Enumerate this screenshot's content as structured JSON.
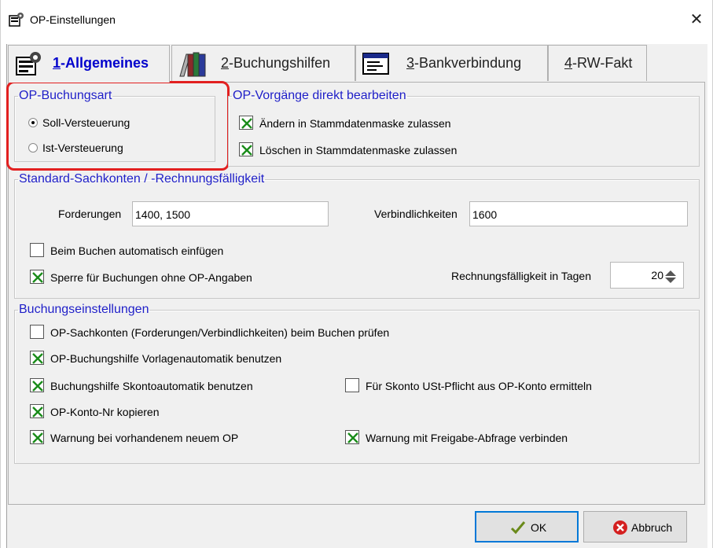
{
  "window": {
    "title": "OP-Einstellungen",
    "close_glyph": "✕",
    "icon": "settings-dialog-icon"
  },
  "tabs": [
    {
      "lead": "1",
      "rest": "-Allgemeines",
      "icon": "settings-icon",
      "active": true
    },
    {
      "lead": "2",
      "rest": "-Buchungshilfen",
      "icon": "books-icon",
      "active": false
    },
    {
      "lead": "3",
      "rest": "-Bankverbindung",
      "icon": "bank-window-icon",
      "active": false
    },
    {
      "lead": "4",
      "rest": "-RW-Fakt",
      "icon": "",
      "active": false
    }
  ],
  "buchungsart": {
    "legend": "OP-Buchungsart",
    "options": [
      {
        "label": "Soll-Versteuerung",
        "checked": true
      },
      {
        "label": "Ist-Versteuerung",
        "checked": false
      }
    ],
    "highlight_color": "#e22020"
  },
  "vorgaenge": {
    "legend": "OP-Vorgänge direkt bearbeiten",
    "items": [
      {
        "label": "Ändern in Stammdatenmaske zulassen",
        "checked": true
      },
      {
        "label": "Löschen in Stammdatenmaske zulassen",
        "checked": true
      }
    ]
  },
  "sachkonten": {
    "legend": "Standard-Sachkonten / -Rechnungsfälligkeit",
    "forderungen_label": "Forderungen",
    "forderungen_value": "1400, 1500",
    "verbindlichkeiten_label": "Verbindlichkeiten",
    "verbindlichkeiten_value": "1600",
    "auto_einfuegen": {
      "label": "Beim Buchen automatisch einfügen",
      "checked": false
    },
    "sperre": {
      "label": "Sperre für Buchungen ohne OP-Angaben",
      "checked": true
    },
    "faelligkeit_label": "Rechnungsfälligkeit in Tagen",
    "faelligkeit_value": "20"
  },
  "einstellungen": {
    "legend": "Buchungseinstellungen",
    "items": [
      {
        "label": "OP-Sachkonten (Forderungen/Verbindlichkeiten) beim Buchen prüfen",
        "checked": false
      },
      {
        "label": "OP-Buchungshilfe Vorlagenautomatik benutzen",
        "checked": true
      },
      {
        "label": "Buchungshilfe Skontoautomatik benutzen",
        "checked": true
      },
      {
        "label": "Für Skonto USt-Pflicht aus OP-Konto ermitteln",
        "checked": false
      },
      {
        "label": "OP-Konto-Nr kopieren",
        "checked": true
      },
      {
        "label": "Warnung bei vorhandenem neuem OP",
        "checked": true
      },
      {
        "label": "Warnung mit Freigabe-Abfrage verbinden",
        "checked": true
      }
    ]
  },
  "buttons": {
    "ok_label": "OK",
    "ok_icon": "checkmark-icon",
    "cancel_label": "Abbruch",
    "cancel_icon": "cancel-icon"
  },
  "colors": {
    "legend_text": "#1e1ec8",
    "active_tab_text": "#0000cc",
    "check_mark": "#1a8c1a"
  }
}
